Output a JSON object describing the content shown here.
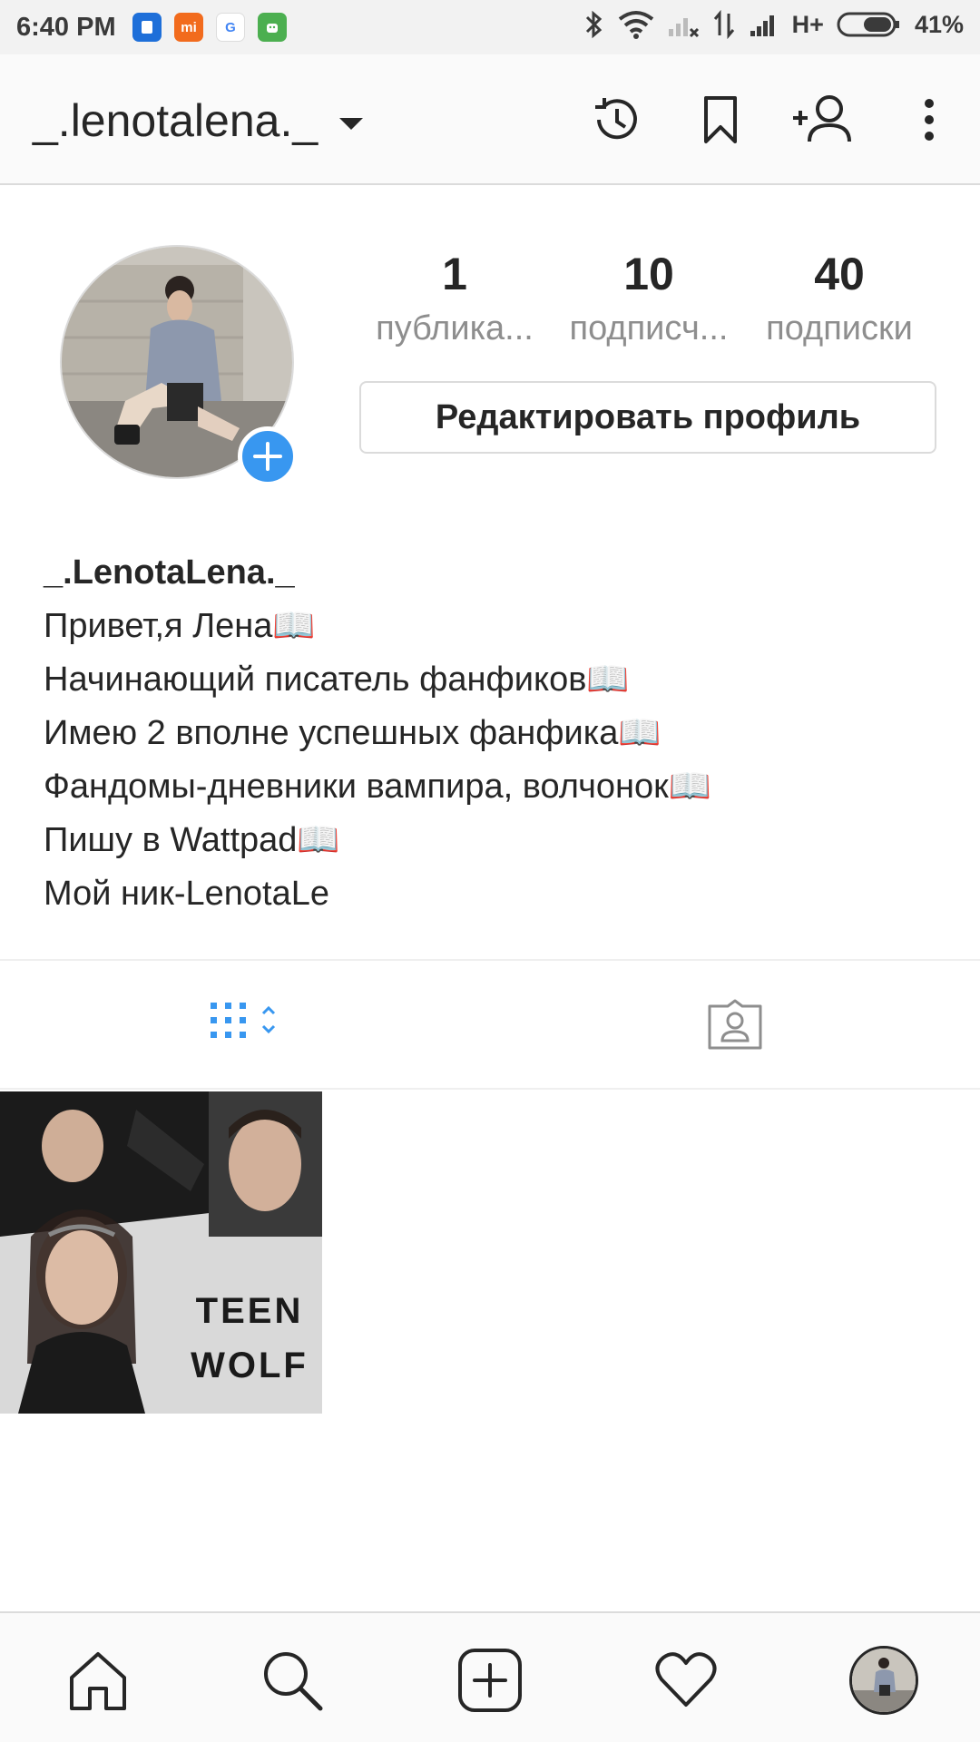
{
  "status_bar": {
    "time": "6:40 PM",
    "network": "H+",
    "battery": "41%",
    "app_icons": [
      "files-app-icon",
      "mi-app-icon",
      "google-app-icon",
      "android-app-icon"
    ],
    "mi_label": "mi",
    "google_label": "G"
  },
  "header": {
    "username": "_.lenotalena._",
    "icons": [
      "history-icon",
      "bookmark-icon",
      "add-person-icon",
      "more-vertical-icon"
    ]
  },
  "profile": {
    "stats": [
      {
        "value": "1",
        "label": "публика..."
      },
      {
        "value": "10",
        "label": "подписч..."
      },
      {
        "value": "40",
        "label": "подписки"
      }
    ],
    "edit_button": "Редактировать профиль"
  },
  "bio": {
    "name": "_.LenotaLena._",
    "lines": [
      "Привет,я Лена📖",
      "Начинающий писатель фанфиков📖",
      "Имею 2 вполне успешных фанфика📖",
      "Фандомы-дневники вампира, волчонок📖",
      "Пишу в Wattpad📖",
      "Мой ник-LenotaLe"
    ]
  },
  "tabs": {
    "grid_icon": "grid-icon",
    "tagged_icon": "tagged-person-icon"
  },
  "posts": [
    {
      "caption": "TEEN WOLF"
    }
  ],
  "bottom_nav": [
    "home-icon",
    "search-icon",
    "add-post-icon",
    "heart-icon",
    "profile-avatar"
  ],
  "colors": {
    "accent": "#3897f0",
    "text": "#262626",
    "muted": "#8e8e8e",
    "divider": "#dbdbdb"
  }
}
